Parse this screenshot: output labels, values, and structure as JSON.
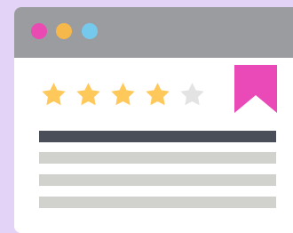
{
  "colors": {
    "background": "#e3d3f6",
    "titlebar": "#9a9c9f",
    "window": "#ffffff",
    "dot_red": "#e94bb3",
    "dot_yellow": "#f6b84a",
    "dot_green": "#75c9ec",
    "star_filled": "#ffc85a",
    "star_empty": "#e3e3e3",
    "bookmark": "#ea4ab8",
    "dark_line": "#4a4e59",
    "light_line": "#d1d1cd"
  },
  "rating": {
    "value": 4,
    "max": 5
  },
  "icons": {
    "dots": [
      "red-dot-icon",
      "yellow-dot-icon",
      "green-dot-icon"
    ],
    "star": "star-icon",
    "bookmark": "bookmark-icon"
  }
}
